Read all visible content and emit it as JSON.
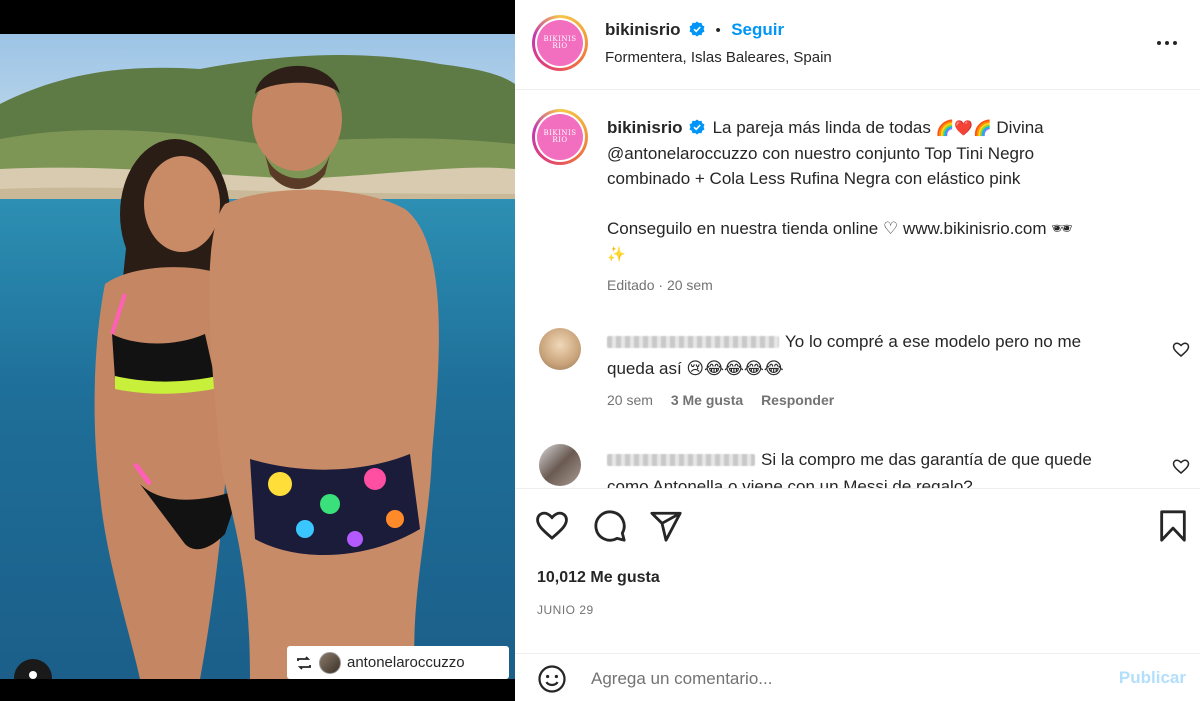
{
  "post": {
    "username": "bikinisrio",
    "follow_label": "Seguir",
    "separator": "•",
    "location": "Formentera, Islas Baleares, Spain",
    "logo_text": "BIKINIS RIO",
    "repost_username": "antonelaroccuzzo"
  },
  "caption": {
    "username": "bikinisrio",
    "line1_text": "La pareja más linda de todas",
    "line1_emojis": "🌈❤️🌈",
    "line1_after": "Divina",
    "line2": "@antonelaroccuzzo con nuestro conjunto Top Tini Negro",
    "line3": "combinado + Cola Less Rufina Negra con elástico pink",
    "line4": "Conseguilo en nuestra tienda online ♡ www.bikinisrio.com 🕶",
    "line5": "✨",
    "edited": "Editado",
    "edited_sep": "·",
    "time": "20 sem"
  },
  "comments": [
    {
      "text_line1": "Yo lo compré a ese modelo pero no me",
      "text_line2": "queda así 😢😂😂😂😂",
      "time": "20 sem",
      "likes": "3 Me gusta",
      "reply": "Responder"
    },
    {
      "text_line1": "Si la compro me das garantía de que quede",
      "text_line2": "como Antonella o viene con un Messi de regalo?"
    }
  ],
  "stats": {
    "likes": "10,012 Me gusta",
    "date": "JUNIO 29"
  },
  "composer": {
    "placeholder": "Agrega un comentario...",
    "publish": "Publicar"
  },
  "colors": {
    "accent": "#0095f6",
    "publish_disabled": "#b2dffc",
    "brand_pink": "#f26fbf",
    "muted_text": "#737373"
  },
  "icons": [
    "verified-icon",
    "more-icon",
    "heart-icon",
    "comment-icon",
    "share-icon",
    "bookmark-icon",
    "emoji-icon",
    "repost-icon",
    "user-tag-icon"
  ]
}
